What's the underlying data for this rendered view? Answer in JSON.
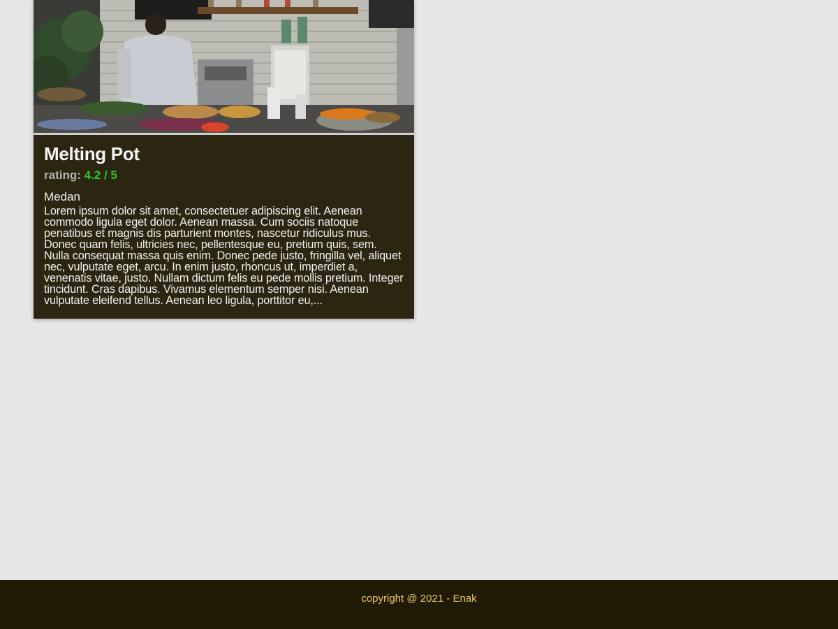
{
  "restaurant": {
    "name": "Melting Pot",
    "rating_label": "rating:",
    "rating_value": "4.2 / 5",
    "rating": 4.2,
    "rating_max": 5,
    "city": "Medan",
    "description": "Lorem ipsum dolor sit amet, consectetuer adipiscing elit. Aenean commodo ligula eget dolor. Aenean massa. Cum sociis natoque penatibus et magnis dis parturient montes, nascetur ridiculus mus. Donec quam felis, ultricies nec, pellentesque eu, pretium quis, sem. Nulla consequat massa quis enim. Donec pede justo, fringilla vel, aliquet nec, vulputate eget, arcu. In enim justo, rhoncus ut, imperdiet a, venenatis vitae, justo. Nullam dictum felis eu pede mollis pretium. Integer tincidunt. Cras dapibus. Vivamus elementum semper nisi. Aenean vulputate eleifend tellus. Aenean leo ligula, porttitor eu,..."
  },
  "footer": {
    "text": "copyright @ 2021 - Enak"
  },
  "colors": {
    "background": "#e6e6e6",
    "card": "#2b2511",
    "rating_value": "#2ec42a",
    "footer_bg": "#201b04",
    "footer_text": "#f0c46a"
  }
}
